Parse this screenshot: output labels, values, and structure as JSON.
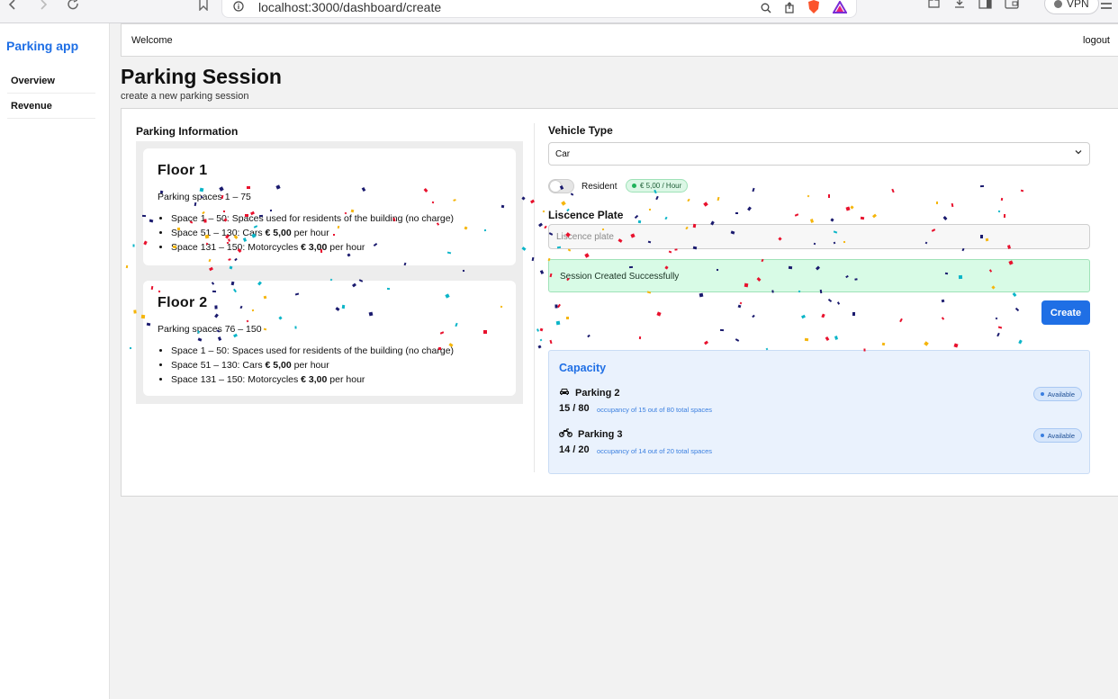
{
  "browser": {
    "url": "localhost:3000/dashboard/create",
    "vpn_label": "VPN"
  },
  "sidebar": {
    "app_title": "Parking app",
    "items": [
      {
        "label": "Overview"
      },
      {
        "label": "Revenue"
      }
    ]
  },
  "header": {
    "welcome": "Welcome",
    "logout": "logout"
  },
  "page": {
    "title": "Parking Session",
    "subtitle": "create a new parking session"
  },
  "parking_info": {
    "title": "Parking Information",
    "floors": [
      {
        "title": "Floor 1",
        "range": "Parking spaces 1 – 75",
        "rules": [
          {
            "text": "Space 1 – 50: Spaces used for residents of the building (no charge)"
          },
          {
            "pre": "Space 51 – 130: Cars ",
            "bold": "€ 5,00",
            "post": " per hour"
          },
          {
            "pre": "Space 131 – 150: Motorcycles ",
            "bold": "€ 3,00",
            "post": " per hour"
          }
        ]
      },
      {
        "title": "Floor 2",
        "range": "Parking spaces 76 – 150",
        "rules": [
          {
            "text": "Space 1 – 50: Spaces used for residents of the building (no charge)"
          },
          {
            "pre": "Space 51 – 130: Cars ",
            "bold": "€ 5,00",
            "post": " per hour"
          },
          {
            "pre": "Space 131 – 150: Motorcycles ",
            "bold": "€ 3,00",
            "post": " per hour"
          }
        ]
      }
    ]
  },
  "form": {
    "vehicle_type_label": "Vehicle Type",
    "vehicle_type_value": "Car",
    "resident_label": "Resident",
    "resident_checked": false,
    "price_badge": "€ 5,00 / Hour",
    "plate_label": "Liscence Plate",
    "plate_placeholder": "Liscence plate",
    "success_message": "Session Created Successfully",
    "create_button": "Create"
  },
  "capacity": {
    "title": "Capacity",
    "rows": [
      {
        "name": "Parking 2",
        "icon": "car-icon",
        "count": "15 / 80",
        "description": "occupancy of 15 out of 80 total spaces",
        "status": "Available"
      },
      {
        "name": "Parking 3",
        "icon": "motorcycle-icon",
        "count": "14 / 20",
        "description": "occupancy of 14 out of 20 total spaces",
        "status": "Available"
      }
    ]
  },
  "colors": {
    "accent": "#1f6fe5",
    "success_bg": "#d8fbe6",
    "capacity_bg": "#eaf2fd",
    "confetti": [
      "#e8112d",
      "#1a1a6e",
      "#f5b50a",
      "#0bb5c8",
      "#e8112d",
      "#1a1a6e"
    ]
  }
}
